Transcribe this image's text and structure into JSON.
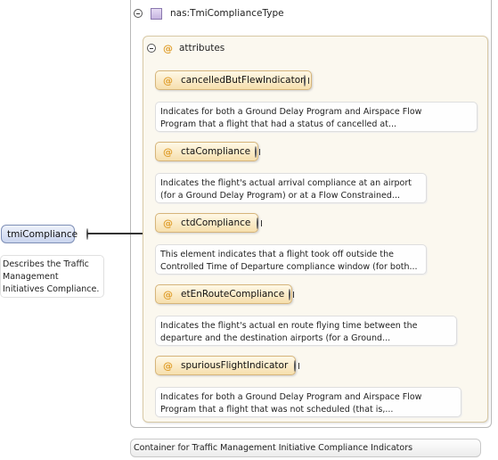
{
  "element": {
    "name": "tmiCompliance",
    "description": "Describes the Traffic\nManagement\nInitiatives Compliance."
  },
  "type": {
    "name": "nas:TmiComplianceType",
    "description": "Container for Traffic Management Initiative Compliance Indicators",
    "icon": "complex-type-icon",
    "color": "#c6b4e0"
  },
  "attributes_group": {
    "label": "attributes",
    "symbol": "@"
  },
  "attributes": [
    {
      "symbol": "@",
      "name": "cancelledButFlewIndicator",
      "description": "Indicates for both a Ground Delay Program and Airspace Flow\nProgram that a flight that had a status of cancelled at..."
    },
    {
      "symbol": "@",
      "name": "ctaCompliance",
      "description": "Indicates the flight's actual arrival compliance at an airport\n(for a Ground Delay Program) or at a Flow Constrained..."
    },
    {
      "symbol": "@",
      "name": "ctdCompliance",
      "description": "This element indicates that a flight took off outside the\nControlled Time of Departure compliance window (for both..."
    },
    {
      "symbol": "@",
      "name": "etEnRouteCompliance",
      "description": "Indicates the flight's actual en route flying time between the\ndeparture and the destination airports (for a Ground..."
    },
    {
      "symbol": "@",
      "name": "spuriousFlightIndicator",
      "description": "Indicates for both a Ground Delay Program and Airspace Flow\nProgram that a flight that was not scheduled (that is,..."
    }
  ],
  "colors": {
    "attribute_symbol": "#e0a030",
    "attribute_fill": "#f6dfad",
    "element_fill": "#c9d4ee"
  }
}
